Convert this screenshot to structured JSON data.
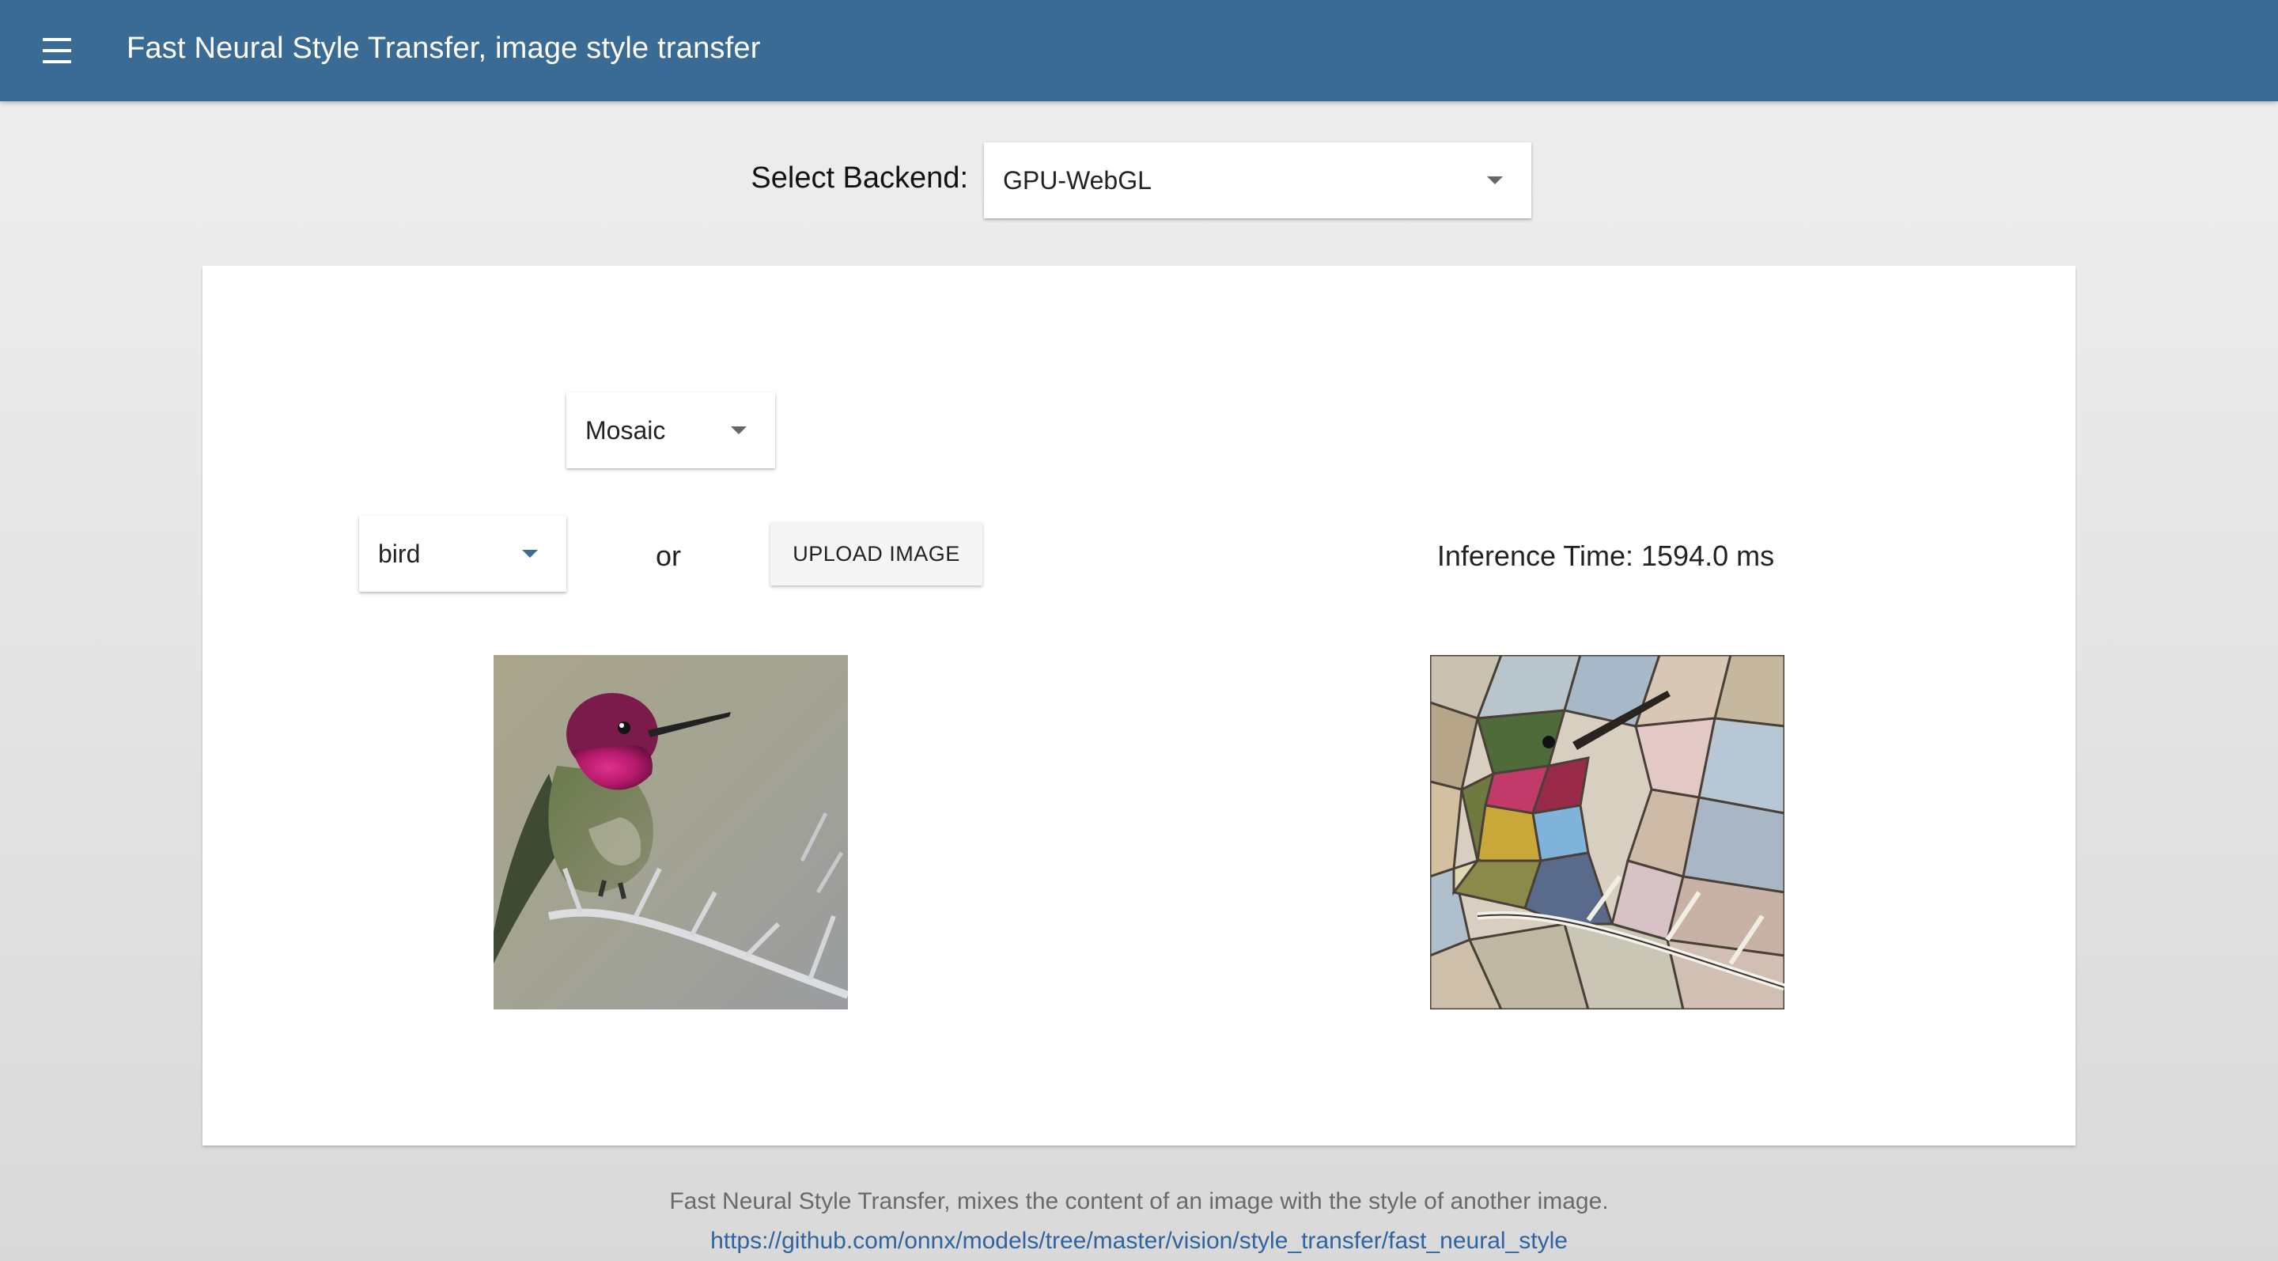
{
  "header": {
    "title": "Fast Neural Style Transfer, image style transfer",
    "menu_icon": "menu-icon",
    "background": "#3a6b94"
  },
  "backend": {
    "label": "Select Backend:",
    "selected": "GPU-WebGL"
  },
  "controls": {
    "style_selected": "Mosaic",
    "image_selected": "bird",
    "or_text": "or",
    "upload_label": "UPLOAD IMAGE"
  },
  "result": {
    "inference_text": "Inference Time: 1594.0 ms"
  },
  "footer": {
    "description": "Fast Neural Style Transfer, mixes the content of an image with the style of another image.",
    "link": "https://github.com/onnx/models/tree/master/vision/style_transfer/fast_neural_style"
  },
  "colors": {
    "accent": "#3a6b94",
    "link": "#2f64a0"
  }
}
